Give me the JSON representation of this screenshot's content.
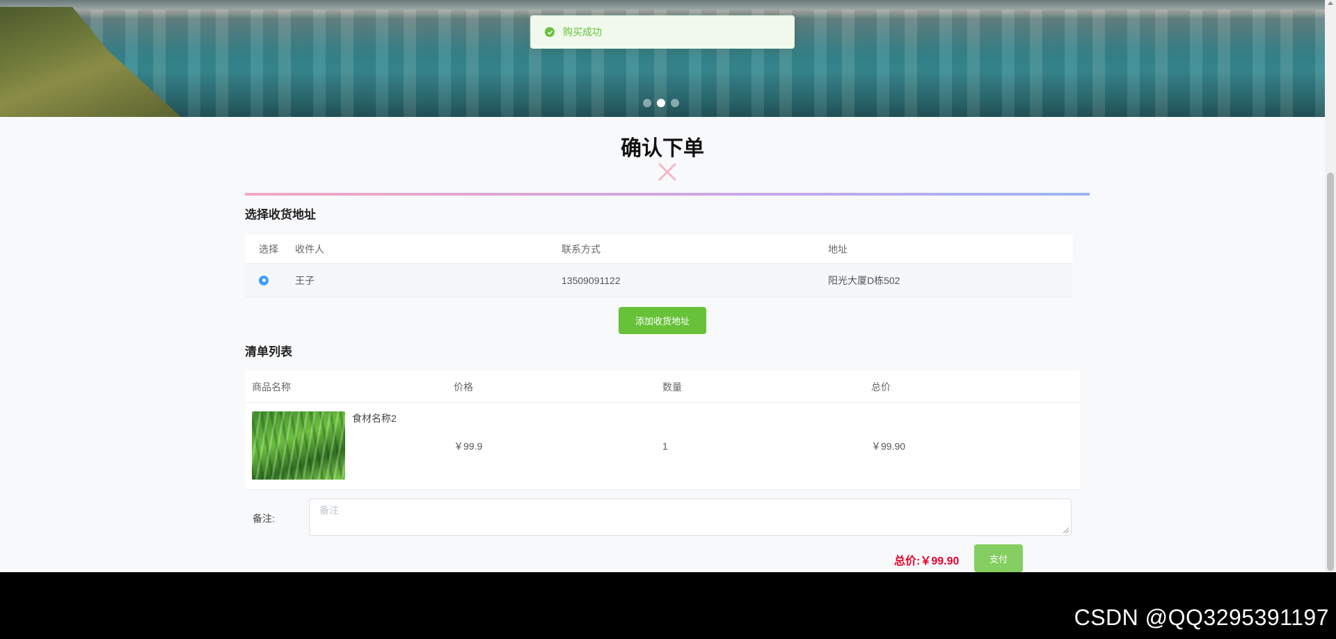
{
  "toast": {
    "message": "购买成功",
    "color": "#67c23a"
  },
  "banner": {
    "dots": 3,
    "active_dot": 2
  },
  "page": {
    "title": "确认下单"
  },
  "address_section": {
    "title": "选择收货地址",
    "columns": [
      "选择",
      "收件人",
      "联系方式",
      "地址"
    ],
    "rows": [
      {
        "selected": true,
        "recipient": "王子",
        "phone": "13509091122",
        "address": "阳光大厦D栋502"
      }
    ],
    "add_button": "添加收货地址"
  },
  "list_section": {
    "title": "清单列表",
    "columns": [
      "商品名称",
      "价格",
      "数量",
      "总价"
    ],
    "rows": [
      {
        "name": "食材名称2",
        "price": "￥99.9",
        "quantity": "1",
        "total": "￥99.90",
        "image_icon": "celery-image"
      }
    ]
  },
  "remark": {
    "label": "备注:",
    "placeholder": "备注"
  },
  "summary": {
    "total_label": "总价:",
    "total_value": "￥99.90",
    "pay_button": "支付"
  },
  "watermark": "CSDN @QQ3295391197",
  "colors": {
    "accent_green": "#67c23a",
    "price_red": "#e4002b",
    "radio_blue": "#409eff"
  }
}
